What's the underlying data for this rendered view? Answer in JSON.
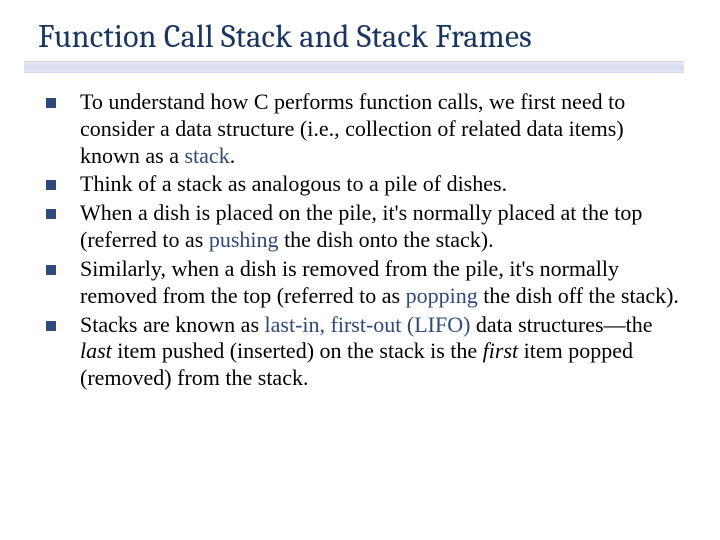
{
  "title": "Function Call Stack and Stack Frames",
  "bullets": [
    {
      "pre": "To understand how C performs function calls, we first need to consider a data structure (i.e., collection of related data items) known as a ",
      "kw1": "stack",
      "post": "."
    },
    {
      "pre": "Think of a stack as analogous to a pile of dishes."
    },
    {
      "pre": "When a dish is placed on the pile, it's normally placed at the top (referred to as ",
      "kw1": "pushing",
      "mid": " the dish onto the stack).",
      "post": ""
    },
    {
      "pre": "Similarly, when a dish is removed from the pile, it's normally removed from the top (referred to as ",
      "kw1": "popping",
      "mid": " the dish off the stack).",
      "post": ""
    },
    {
      "pre": "Stacks are known as ",
      "kw1": "last-in, first-out (LIFO)",
      "mid": " data structures—the ",
      "it1": "last",
      "mid2": " item pushed (inserted) on the stack is the ",
      "it2": "first",
      "post": " item popped (removed) from the stack."
    }
  ]
}
